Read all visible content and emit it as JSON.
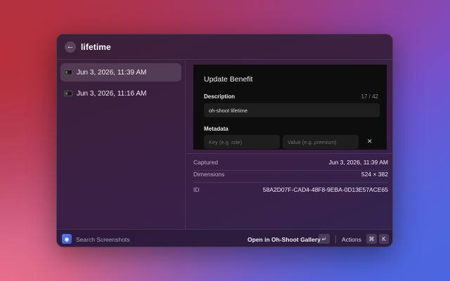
{
  "search": {
    "query": "lifetime"
  },
  "list": {
    "items": [
      {
        "label": "Jun 3, 2026, 11:39 AM",
        "selected": true
      },
      {
        "label": "Jun 3, 2026, 11:16 AM",
        "selected": false
      }
    ]
  },
  "preview": {
    "title": "Update Benefit",
    "description_label": "Description",
    "char_count": "17 / 42",
    "description_value": "oh-shoot lifetime",
    "metadata_label": "Metadata",
    "key_placeholder": "Key (e.g. role)",
    "value_placeholder": "Value (e.g. premium)",
    "remove_glyph": "✕"
  },
  "details": [
    {
      "key": "Captured",
      "value": "Jun 3, 2026, 11:39 AM"
    },
    {
      "key": "Dimensions",
      "value": "524 × 382"
    },
    {
      "key": "ID",
      "value": "58A2D07F-CAD4-48F8-9EBA-0D13E57ACE65"
    }
  ],
  "footer": {
    "search_placeholder": "Search Screenshots",
    "primary_action": "Open in Oh-Shoot Gallery",
    "enter_key": "↵",
    "actions_label": "Actions",
    "cmd_key": "⌘",
    "k_key": "K"
  },
  "colors": {
    "accent": "#4b68e0",
    "window_bg": "#3a2046",
    "preview_bg": "#0d0d0d"
  }
}
